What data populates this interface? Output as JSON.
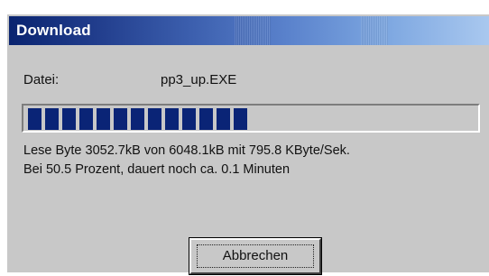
{
  "window": {
    "title": "Download"
  },
  "file": {
    "label": "Datei:",
    "name": "pp3_up.EXE"
  },
  "progress": {
    "percent": 50.5,
    "segments_filled": 13
  },
  "status": {
    "line1": "Lese Byte 3052.7kB von 6048.1kB mit 795.8 KByte/Sek.",
    "line2": "Bei 50.5 Prozent, dauert noch ca. 0.1 Minuten"
  },
  "buttons": {
    "cancel_label": "Abbrechen"
  },
  "colors": {
    "title_gradient_start": "#0a2470",
    "title_gradient_end": "#a9c8ef",
    "progress_fill": "#0a2476",
    "dialog_face": "#c8c8c8"
  }
}
